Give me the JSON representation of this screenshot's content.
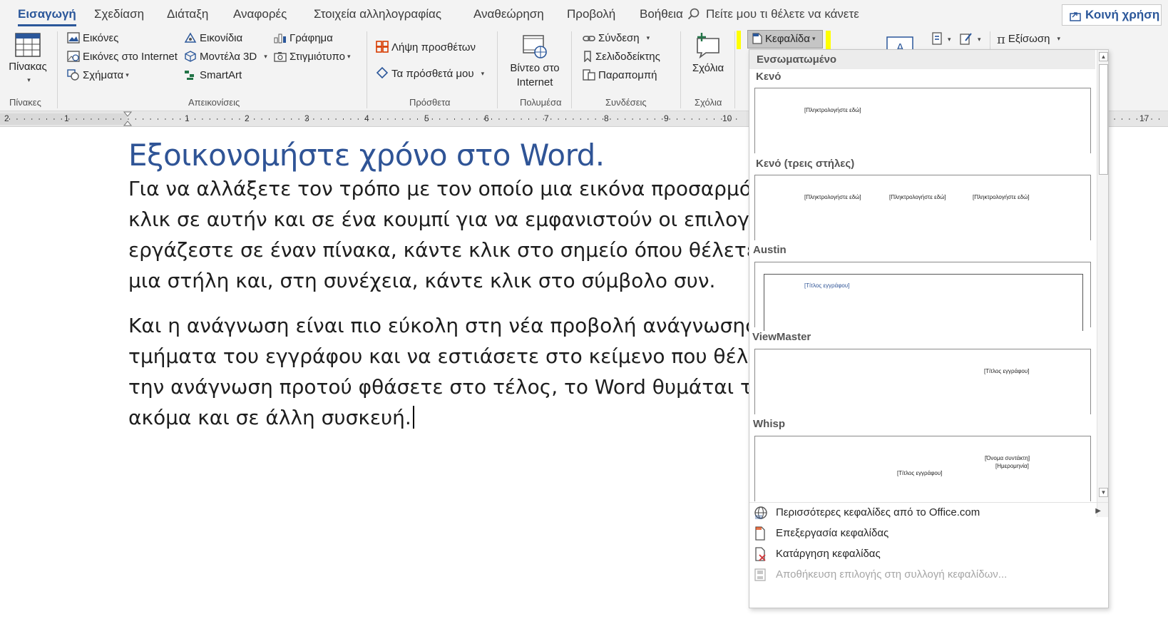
{
  "tabs": [
    "Εισαγωγή",
    "Σχεδίαση",
    "Διάταξη",
    "Αναφορές",
    "Στοιχεία αλληλογραφίας",
    "Αναθεώρηση",
    "Προβολή",
    "Βοήθεια"
  ],
  "tell_me": "Πείτε μου τι θέλετε να κάνετε",
  "share_label": "Κοινή χρήση",
  "ribbon": {
    "tables": {
      "button": "Πίνακας",
      "group": "Πίνακες"
    },
    "illustrations": {
      "pictures": "Εικόνες",
      "online_pictures": "Εικόνες στο Internet",
      "shapes": "Σχήματα",
      "icons": "Εικονίδια",
      "models_3d": "Μοντέλα 3D",
      "smartart": "SmartArt",
      "chart": "Γράφημα",
      "screenshot": "Στιγμιότυπο",
      "group": "Απεικονίσεις"
    },
    "addins": {
      "get": "Λήψη προσθέτων",
      "my": "Τα πρόσθετά μου",
      "group": "Πρόσθετα"
    },
    "media": {
      "video_line1": "Βίντεο στο",
      "video_line2": "Internet",
      "group": "Πολυμέσα"
    },
    "links": {
      "link": "Σύνδεση",
      "bookmark": "Σελιδοδείκτης",
      "crossref": "Παραπομπή",
      "group": "Συνδέσεις"
    },
    "comments": {
      "comment": "Σχόλια",
      "group": "Σχόλια"
    },
    "header_button": "Κεφαλίδα",
    "equation": "Εξίσωση"
  },
  "ruler": [
    "2",
    "1",
    "1",
    "2",
    "3",
    "4",
    "5",
    "6",
    "7",
    "8",
    "9",
    "10",
    "17"
  ],
  "document": {
    "title": "Εξοικονομήστε χρόνο στο Word.",
    "para1": [
      "Για να αλλάξετε τον τρόπο με τον οποίο μια εικόνα προσαρμόζετα",
      "κλικ σε αυτήν και σε ένα κουμπί για να εμφανιστούν οι επιλογές",
      "εργάζεστε σε έναν πίνακα, κάντε κλικ στο σημείο όπου θέλετε να",
      "μια στήλη και, στη συνέχεια, κάντε κλικ στο σύμβολο συν."
    ],
    "para2": [
      "Και η ανάγνωση είναι πιο εύκολη στη νέα προβολή ανάγνωσης. Μ",
      "τμήματα του εγγράφου και να εστιάσετε στο κείμενο που θέλετε",
      "την ανάγνωση προτού φθάσετε στο τέλος, το Word θυμάται το ση",
      "ακόμα και σε άλλη συσκευή."
    ]
  },
  "dropdown": {
    "section_header": "Ενσωματωμένο",
    "items": [
      {
        "label": "Κενό",
        "placeholders": [
          "[Πληκτρολογήστε εδώ]"
        ]
      },
      {
        "label": "Κενό (τρεις στήλες)",
        "placeholders": [
          "[Πληκτρολογήστε εδώ]",
          "[Πληκτρολογήστε εδώ]",
          "[Πληκτρολογήστε εδώ]"
        ]
      },
      {
        "label": "Austin",
        "placeholders": [
          "[Τίτλος εγγράφου]"
        ]
      },
      {
        "label": "ViewMaster",
        "placeholders": [
          "[Τίτλος εγγράφου]"
        ]
      },
      {
        "label": "Whisp",
        "placeholders": [
          "[Όνομα συντάκτη]",
          "[Ημερομηνία]",
          "[Τίτλος εγγράφου]"
        ]
      }
    ],
    "menu": {
      "more": "Περισσότερες κεφαλίδες από το Office.com",
      "edit": "Επεξεργασία κεφαλίδας",
      "remove": "Κατάργηση κεφαλίδας",
      "save": "Αποθήκευση επιλογής στη συλλογή κεφαλίδων..."
    }
  },
  "colors": {
    "accent": "#2b579a",
    "title": "#2f5496",
    "highlight": "#ffff00",
    "add_in_icon": "#d83b01"
  }
}
